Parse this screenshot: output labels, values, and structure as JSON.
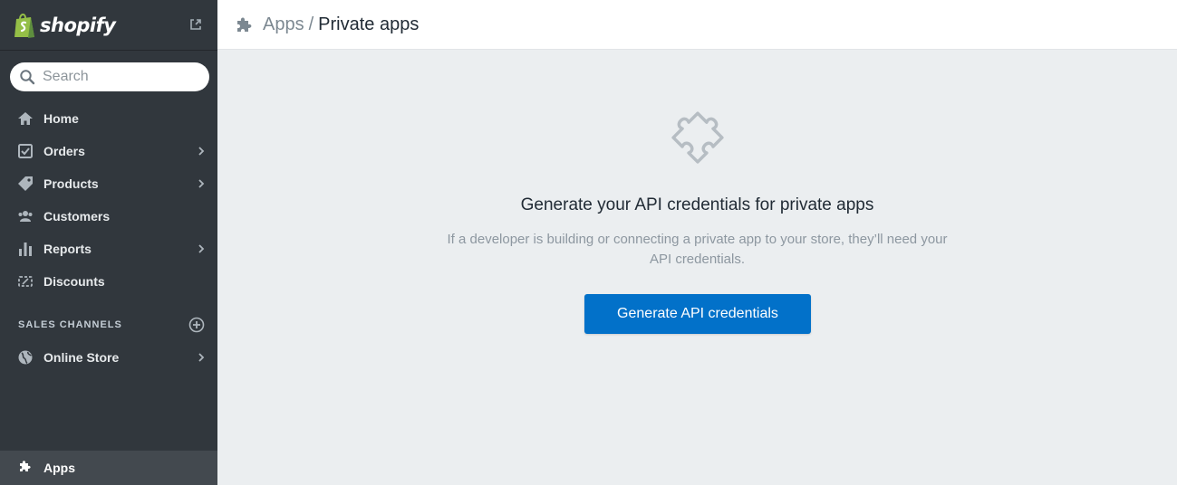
{
  "brand": {
    "name": "shopify",
    "accent": "#95bf47"
  },
  "search": {
    "placeholder": "Search"
  },
  "nav": [
    {
      "label": "Home",
      "icon": "home-icon",
      "chevron": false
    },
    {
      "label": "Orders",
      "icon": "orders-icon",
      "chevron": true
    },
    {
      "label": "Products",
      "icon": "tag-icon",
      "chevron": true
    },
    {
      "label": "Customers",
      "icon": "customers-icon",
      "chevron": false
    },
    {
      "label": "Reports",
      "icon": "bar-chart-icon",
      "chevron": true
    },
    {
      "label": "Discounts",
      "icon": "discount-icon",
      "chevron": false
    }
  ],
  "sales_channels": {
    "heading": "SALES CHANNELS",
    "items": [
      {
        "label": "Online Store",
        "icon": "globe-icon",
        "chevron": true
      }
    ]
  },
  "apps_item": {
    "label": "Apps",
    "icon": "puzzle-icon",
    "active": true
  },
  "header": {
    "breadcrumb": "Apps",
    "separator": "/",
    "title": "Private apps"
  },
  "empty_state": {
    "headline": "Generate your API credentials for private apps",
    "description": "If a developer is building or connecting a private app to your store, they’ll need your API credentials.",
    "button_label": "Generate API credentials"
  },
  "colors": {
    "sidebar": "#31373d",
    "primary_button": "#0271c9",
    "page_bg": "#ebeef0"
  }
}
